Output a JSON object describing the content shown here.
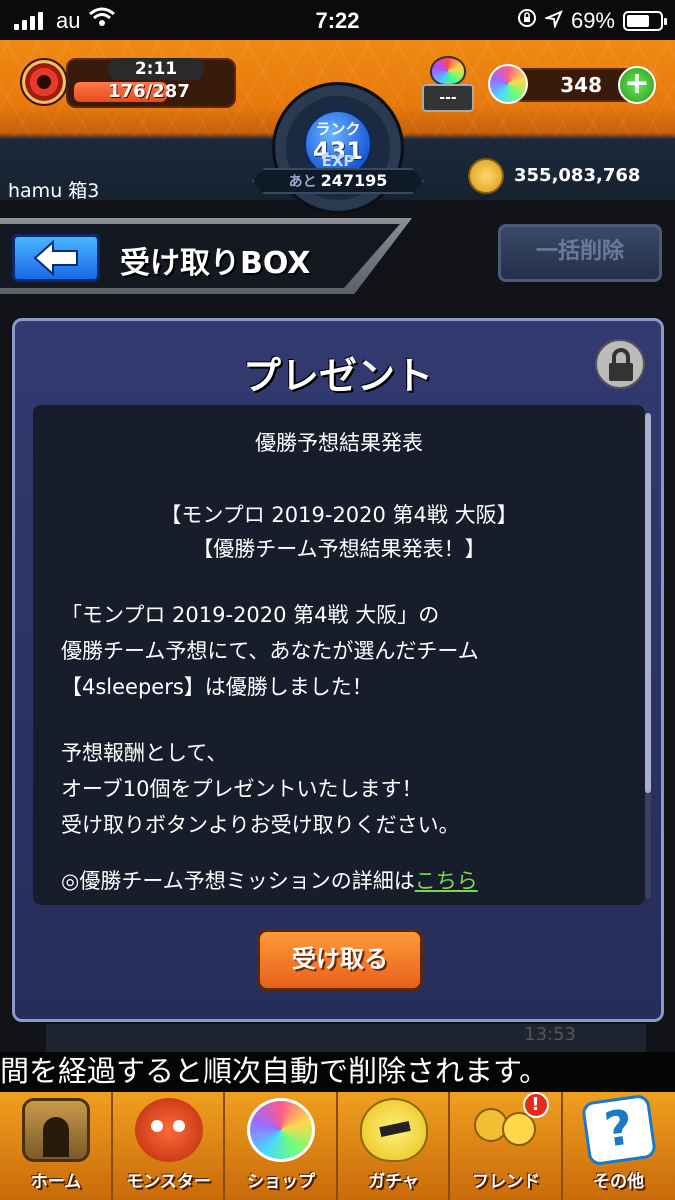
{
  "status_bar": {
    "carrier": "au",
    "time": "7:22",
    "battery_percent": "69%",
    "battery_level": 0.69
  },
  "header": {
    "stamina_timer": "2:11",
    "stamina_count": "176/287",
    "stamina_level": 0.61,
    "rank_label": "ランク",
    "rank_value": "431",
    "exp_label": "EXP",
    "exp_prefix": "あと",
    "exp_remaining": "247195",
    "gem_stand_text": "---",
    "orb_count": "348",
    "orb_plus": "+",
    "username": "hamu 箱3",
    "gold": "355,083,768"
  },
  "title_bar": {
    "back_icon": "back-arrow-icon",
    "title": "受け取りBOX",
    "delete_all_label": "一括削除"
  },
  "dialog": {
    "title": "プレゼント",
    "lock_icon": "lock-icon",
    "lines": {
      "heading": "優勝予想結果発表",
      "event_line1": "【モンプロ 2019-2020 第4戦 大阪】",
      "event_line2": "【優勝チーム予想結果発表！】",
      "body1": "「モンプロ 2019-2020 第4戦 大阪」の",
      "body2": "優勝チーム予想にて、あなたが選んだチーム",
      "body3": "【4sleepers】は優勝しました！",
      "reward1": "予想報酬として、",
      "reward2": "オーブ10個をプレゼントいたします！",
      "reward3": "受け取りボタンよりお受け取りください。",
      "detail_prefix": "◎優勝チーム予想ミッションの詳細は",
      "detail_link": "こちら"
    },
    "receive_label": "受け取る"
  },
  "background": {
    "card_value": "13:53",
    "notice": "間を経過すると順次自動で削除されます。"
  },
  "bottom_nav": {
    "items": [
      {
        "label": "ホーム",
        "icon": "home-gate-icon"
      },
      {
        "label": "モンスター",
        "icon": "monster-icon"
      },
      {
        "label": "ショップ",
        "icon": "orb-shop-icon"
      },
      {
        "label": "ガチャ",
        "icon": "gacha-egg-icon"
      },
      {
        "label": "フレンド",
        "icon": "friend-icon"
      },
      {
        "label": "その他",
        "icon": "question-mark-icon"
      }
    ],
    "friend_badge": "!"
  },
  "colors": {
    "accent_orange": "#e87a0c",
    "dialog_blue": "#2c3466",
    "link_green": "#7ad84a"
  }
}
